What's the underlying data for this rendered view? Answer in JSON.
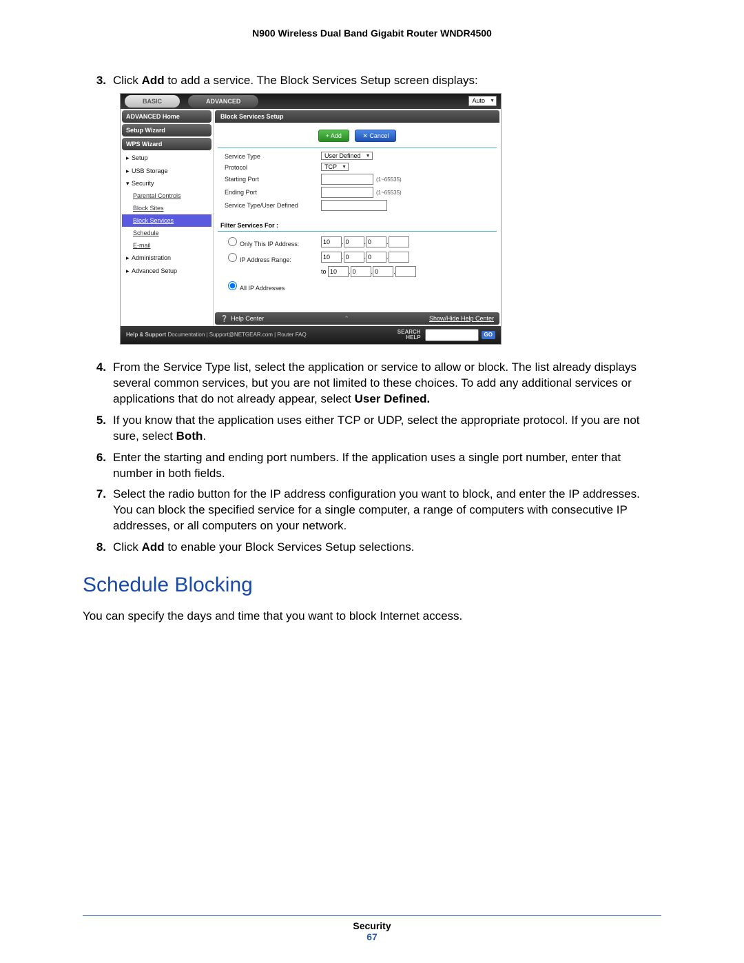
{
  "doc": {
    "header": "N900 Wireless Dual Band Gigabit Router WNDR4500",
    "footer_section": "Security",
    "page_number": "67"
  },
  "steps": {
    "s3_pre": "Click ",
    "s3_b": "Add",
    "s3_post": " to add a service. The Block Services Setup screen displays:",
    "s4_pre": "From the Service Type list, select the application or service to allow or block. The list already displays several common services, but you are not limited to these choices. To add any additional services or applications that do not already appear, select ",
    "s4_b": "User Defined.",
    "s5_pre": "If you know that the application uses either TCP or UDP, select the appropriate protocol. If you are not sure, select ",
    "s5_b": "Both",
    "s5_post": ".",
    "s6": "Enter the starting and ending port numbers. If the application uses a single port number, enter that number in both fields.",
    "s7": "Select the radio button for the IP address configuration you want to block, and enter the IP addresses. You can block the specified service for a single computer, a range of computers with consecutive IP addresses, or all computers on your network.",
    "s8_pre": "Click ",
    "s8_b": "Add",
    "s8_post": " to enable your Block Services Setup selections."
  },
  "section_heading": "Schedule Blocking",
  "section_body": "You can specify the days and time that you want to block Internet access.",
  "router": {
    "tabs": {
      "basic": "BASIC",
      "advanced": "ADVANCED",
      "auto": "Auto"
    },
    "sidebar": {
      "home": "ADVANCED Home",
      "setup_wizard": "Setup Wizard",
      "wps_wizard": "WPS Wizard",
      "items": [
        {
          "label": "Setup",
          "arrow": "▸"
        },
        {
          "label": "USB Storage",
          "arrow": "▸"
        },
        {
          "label": "Security",
          "arrow": "▾"
        }
      ],
      "sub": [
        {
          "label": "Parental Controls"
        },
        {
          "label": "Block Sites"
        },
        {
          "label": "Block Services",
          "active": true
        },
        {
          "label": "Schedule"
        },
        {
          "label": "E-mail"
        }
      ],
      "items2": [
        {
          "label": "Administration",
          "arrow": "▸"
        },
        {
          "label": "Advanced Setup",
          "arrow": "▸"
        }
      ]
    },
    "main": {
      "title": "Block Services Setup",
      "add_btn": "+ Add",
      "cancel_btn": "✕ Cancel",
      "fields": {
        "service_type": {
          "label": "Service Type",
          "value": "User Defined"
        },
        "protocol": {
          "label": "Protocol",
          "value": "TCP"
        },
        "starting_port": {
          "label": "Starting Port",
          "hint": "(1~65535)"
        },
        "ending_port": {
          "label": "Ending Port",
          "hint": "(1~65535)"
        },
        "user_defined": {
          "label": "Service Type/User Defined"
        }
      },
      "filter_title": "Filter Services For :",
      "filter": {
        "only_label": "Only This IP Address:",
        "range_label": "IP Address Range:",
        "all_label": "All IP Addresses",
        "to": "to",
        "ip": {
          "a": "10",
          "b": "0",
          "c": "0",
          "d": ""
        }
      },
      "help": {
        "label": "Help Center",
        "toggle": "Show/Hide Help Center"
      },
      "footer": {
        "help_support": "Help & Support",
        "links": "Documentation  |  Support@NETGEAR.com  |  Router FAQ",
        "search": "SEARCH HELP",
        "go": "GO"
      }
    }
  }
}
